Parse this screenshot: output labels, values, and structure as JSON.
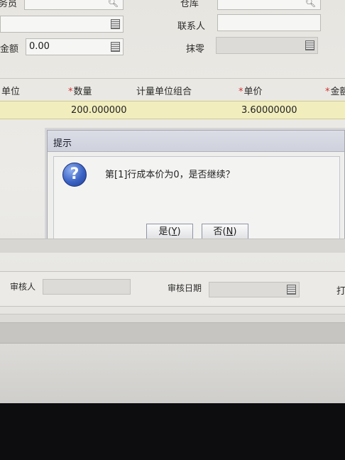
{
  "form": {
    "row1": {
      "field_value_label": "务员",
      "warehouse_label": "仓库",
      "warehouse_value": ""
    },
    "row2": {
      "contact_label": "联系人"
    },
    "row3": {
      "amount_label": "金额",
      "amount_value": "0.00",
      "rounding_label": "抹零"
    }
  },
  "grid": {
    "headers": [
      {
        "label": "单位",
        "required": false
      },
      {
        "label": "数量",
        "required": true
      },
      {
        "label": "计量单位组合",
        "required": false
      },
      {
        "label": "单价",
        "required": true
      },
      {
        "label": "金额",
        "required": true
      }
    ],
    "required_mark": "*",
    "selected_row": {
      "quantity": "200.000000",
      "unit_price": "3.60000000"
    }
  },
  "dialog": {
    "title": "提示",
    "message": "第[1]行成本价为0，是否继续？",
    "yes_button": "是(Y)",
    "yes_label": "是(",
    "yes_key": "Y",
    "no_label": "否(",
    "no_key": "N",
    "close_paren": ")",
    "icon": "question-icon"
  },
  "footer_form": {
    "reviewer_label": "审核人",
    "review_date_label": "审核日期",
    "partial_label": "打"
  },
  "colors": {
    "selected_row": "#f1edbd",
    "dialog_title": "#d3d5e0",
    "required": "#d23030",
    "question_icon": "#3b63c4"
  }
}
